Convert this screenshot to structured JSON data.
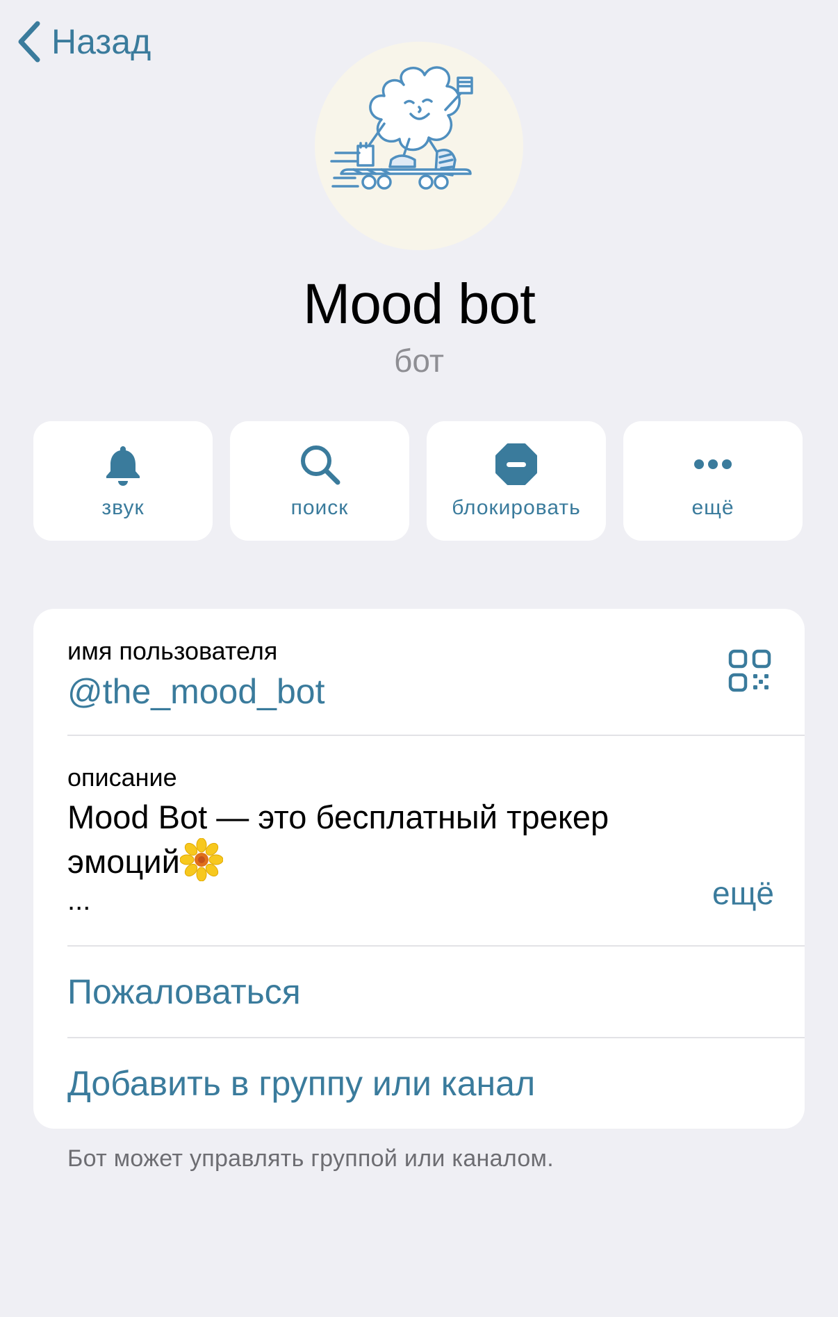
{
  "nav": {
    "back_label": "Назад"
  },
  "profile": {
    "name": "Mood bot",
    "type": "бот"
  },
  "actions": [
    {
      "label": "звук",
      "icon": "bell-icon"
    },
    {
      "label": "поиск",
      "icon": "search-icon"
    },
    {
      "label": "блокировать",
      "icon": "block-icon"
    },
    {
      "label": "ещё",
      "icon": "more-dots-icon"
    }
  ],
  "info": {
    "username_label": "имя пользователя",
    "username": "@the_mood_bot",
    "description_label": "описание",
    "description_line1": "Mood Bot — это бесплатный трекер",
    "description_line2": "эмоций",
    "description_ellipsis": "...",
    "more_label": "ещё",
    "report_label": "Пожаловаться",
    "add_label": "Добавить в группу или канал"
  },
  "footnote": "Бот может управлять группой или каналом.",
  "colors": {
    "background": "#efeff4",
    "accent": "#3a7b9c",
    "secondary_text": "#8e8e93",
    "avatar_bg": "#f8f5ea"
  }
}
